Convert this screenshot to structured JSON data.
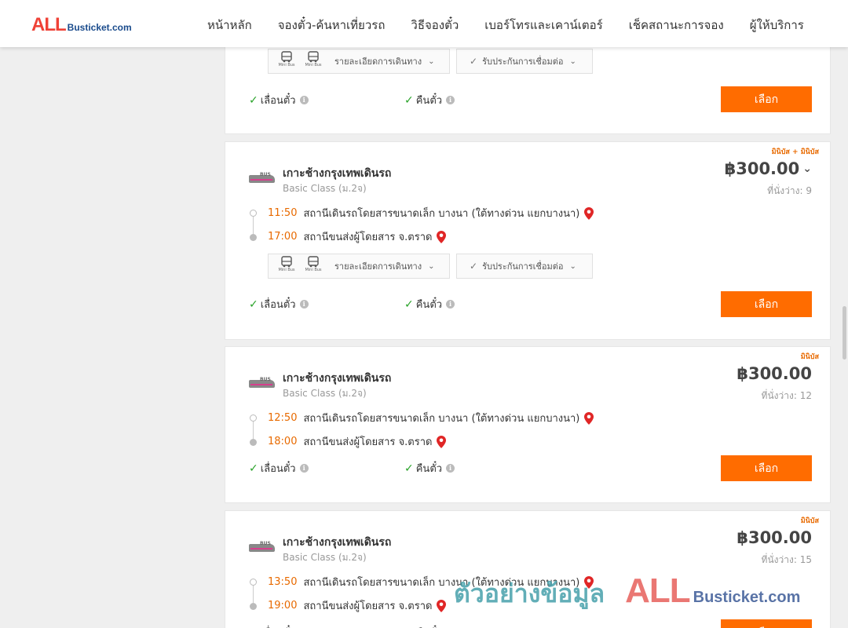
{
  "brand": {
    "logo_all": "ALL",
    "logo_rest": "Busticket.com"
  },
  "nav": [
    {
      "label": "หน้าหลัก"
    },
    {
      "label": "จองตั๋ว-ค้นหาเที่ยวรถ"
    },
    {
      "label": "วิธีจองตั๋ว"
    },
    {
      "label": "เบอร์โทรและเคาน์เตอร์"
    },
    {
      "label": "เช็คสถานะการจอง"
    },
    {
      "label": "ผู้ให้บริการ"
    }
  ],
  "common": {
    "details_label": "รายละเอียดการเดินทาง",
    "insurance_label": "รับประกันการเชื่อมต่อ",
    "reschedule_label": "เลื่อนตั๋ว",
    "refund_label": "คืนตั๋ว",
    "select_label": "เลือก",
    "minibus_icon_label": "Mini Bus",
    "seats_prefix": "ที่นั่งว่าง:",
    "info_glyph": "i"
  },
  "trips": [
    {
      "badge": "",
      "operator": "",
      "class": "",
      "price": "",
      "seats": "",
      "depart_time": "",
      "depart_place": "",
      "arrive_time": "",
      "arrive_place": ""
    },
    {
      "badge": "มินิบัส + มินิบัส",
      "operator": "เกาะช้างกรุงเทพเดินรถ",
      "class": "Basic Class (ม.2จ)",
      "price": "฿300.00",
      "seats": "9",
      "depart_time": "11:50",
      "depart_place": "สถานีเดินรถโดยสารขนาดเล็ก บางนา (ใต้ทางด่วน แยกบางนา)",
      "arrive_time": "17:00",
      "arrive_place": "สถานีขนส่งผู้โดยสาร จ.ตราด"
    },
    {
      "badge": "มินิบัส",
      "operator": "เกาะช้างกรุงเทพเดินรถ",
      "class": "Basic Class (ม.2จ)",
      "price": "฿300.00",
      "seats": "12",
      "depart_time": "12:50",
      "depart_place": "สถานีเดินรถโดยสารขนาดเล็ก บางนา (ใต้ทางด่วน แยกบางนา)",
      "arrive_time": "18:00",
      "arrive_place": "สถานีขนส่งผู้โดยสาร จ.ตราด"
    },
    {
      "badge": "มินิบัส",
      "operator": "เกาะช้างกรุงเทพเดินรถ",
      "class": "Basic Class (ม.2จ)",
      "price": "฿300.00",
      "seats": "15",
      "depart_time": "13:50",
      "depart_place": "สถานีเดินรถโดยสารขนาดเล็ก บางนา (ใต้ทางด่วน แยกบางนา)",
      "arrive_time": "19:00",
      "arrive_place": "สถานีขนส่งผู้โดยสาร จ.ตราด"
    }
  ],
  "watermark": {
    "text_th": "ตัวอย่างข้อมูล",
    "logo_all": "ALL",
    "logo_rest": "Busticket.com"
  }
}
